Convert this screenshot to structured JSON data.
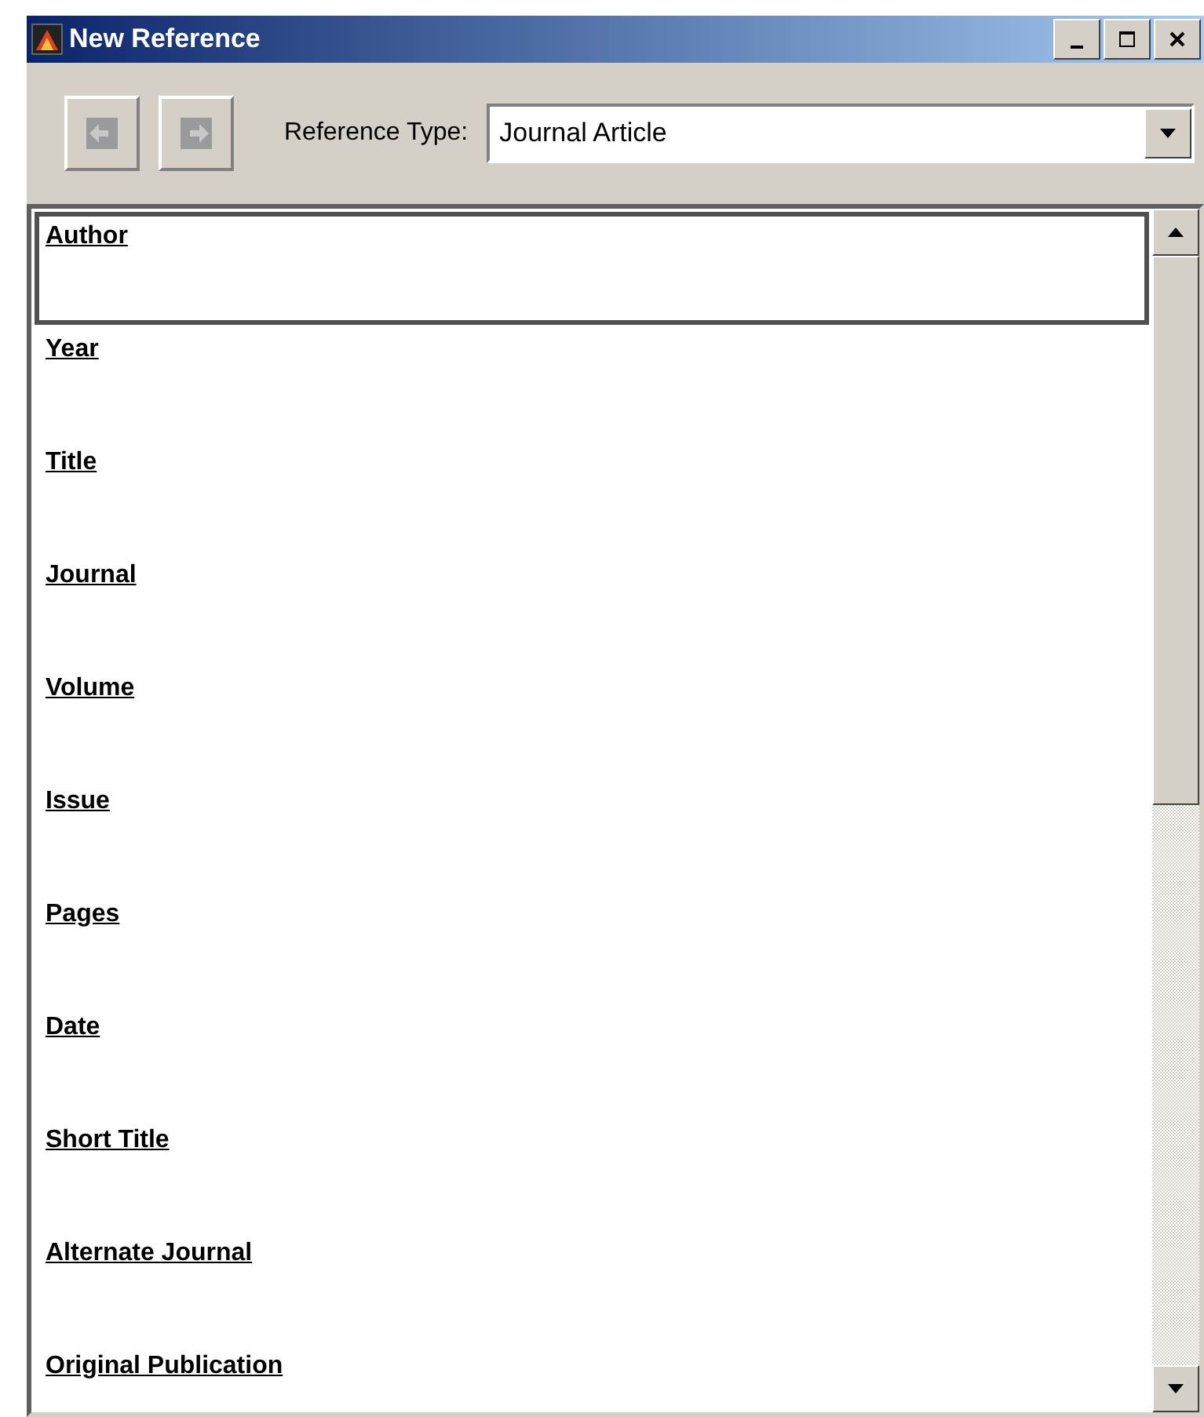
{
  "window": {
    "title": "New Reference"
  },
  "toolbar": {
    "reference_type": {
      "label": "Reference Type:",
      "value": "Journal Article"
    }
  },
  "fields": [
    {
      "label": "Author",
      "selected": true
    },
    {
      "label": "Year",
      "selected": false
    },
    {
      "label": "Title",
      "selected": false
    },
    {
      "label": "Journal",
      "selected": false
    },
    {
      "label": "Volume",
      "selected": false
    },
    {
      "label": "Issue",
      "selected": false
    },
    {
      "label": "Pages",
      "selected": false
    },
    {
      "label": "Date",
      "selected": false
    },
    {
      "label": "Short Title",
      "selected": false
    },
    {
      "label": "Alternate Journal",
      "selected": false
    },
    {
      "label": "Original Publication",
      "selected": false
    }
  ]
}
